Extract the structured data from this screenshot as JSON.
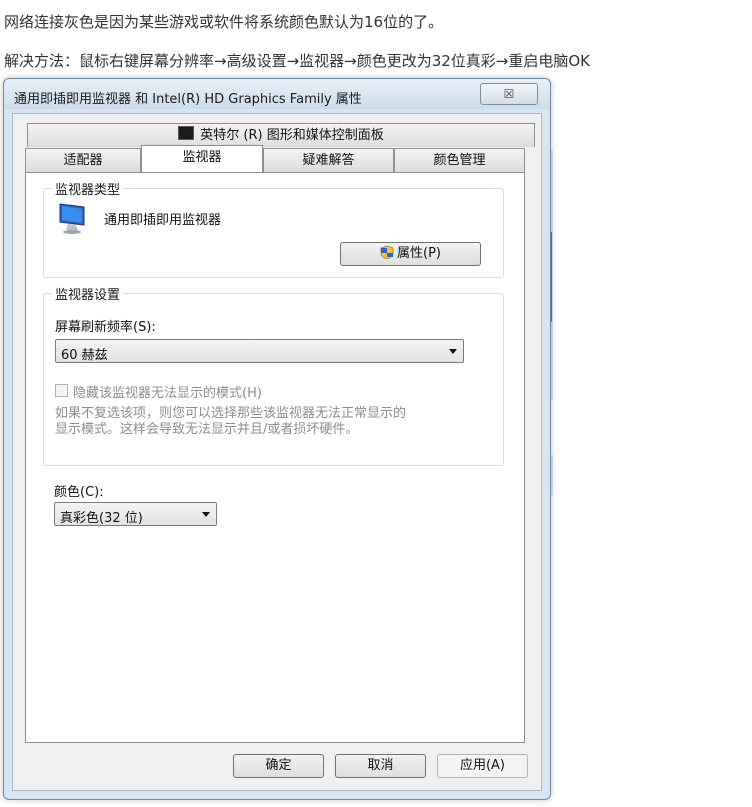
{
  "article": {
    "line1": "网络连接灰色是因为某些游戏或软件将系统颜色默认为16位的了。",
    "line2": "解决方法：鼠标右键屏幕分辨率→高级设置→监视器→颜色更改为32位真彩→重启电脑OK"
  },
  "dialog": {
    "title": "通用即插即用监视器 和 Intel(R) HD Graphics Family 属性",
    "close_label": "☒",
    "tabs_top": [
      {
        "label": "英特尔 (R) 图形和媒体控制面板"
      }
    ],
    "tabs": [
      {
        "label": "适配器"
      },
      {
        "label": "监视器",
        "active": true
      },
      {
        "label": "疑难解答"
      },
      {
        "label": "颜色管理"
      }
    ],
    "monitor_type": {
      "group_title": "监视器类型",
      "monitor_name": "通用即插即用监视器",
      "properties_button": "属性(P)"
    },
    "monitor_settings": {
      "group_title": "监视器设置",
      "refresh_label": "屏幕刷新频率(S):",
      "refresh_value": "60 赫兹",
      "hide_modes_label": "隐藏该监视器无法显示的模式(H)",
      "hide_modes_checked": false,
      "hint_line1": "如果不复选该项，则您可以选择那些该监视器无法正常显示的",
      "hint_line2": "显示模式。这样会导致无法显示并且/或者损坏硬件。"
    },
    "color": {
      "label": "颜色(C):",
      "value": "真彩色(32 位)"
    },
    "footer": {
      "ok": "确定",
      "cancel": "取消",
      "apply": "应用(A)"
    }
  },
  "colors": {
    "dialog_frame": "#d7e4f2",
    "client_bg": "#f0f0f0",
    "tab_body_bg": "#ffffff"
  }
}
